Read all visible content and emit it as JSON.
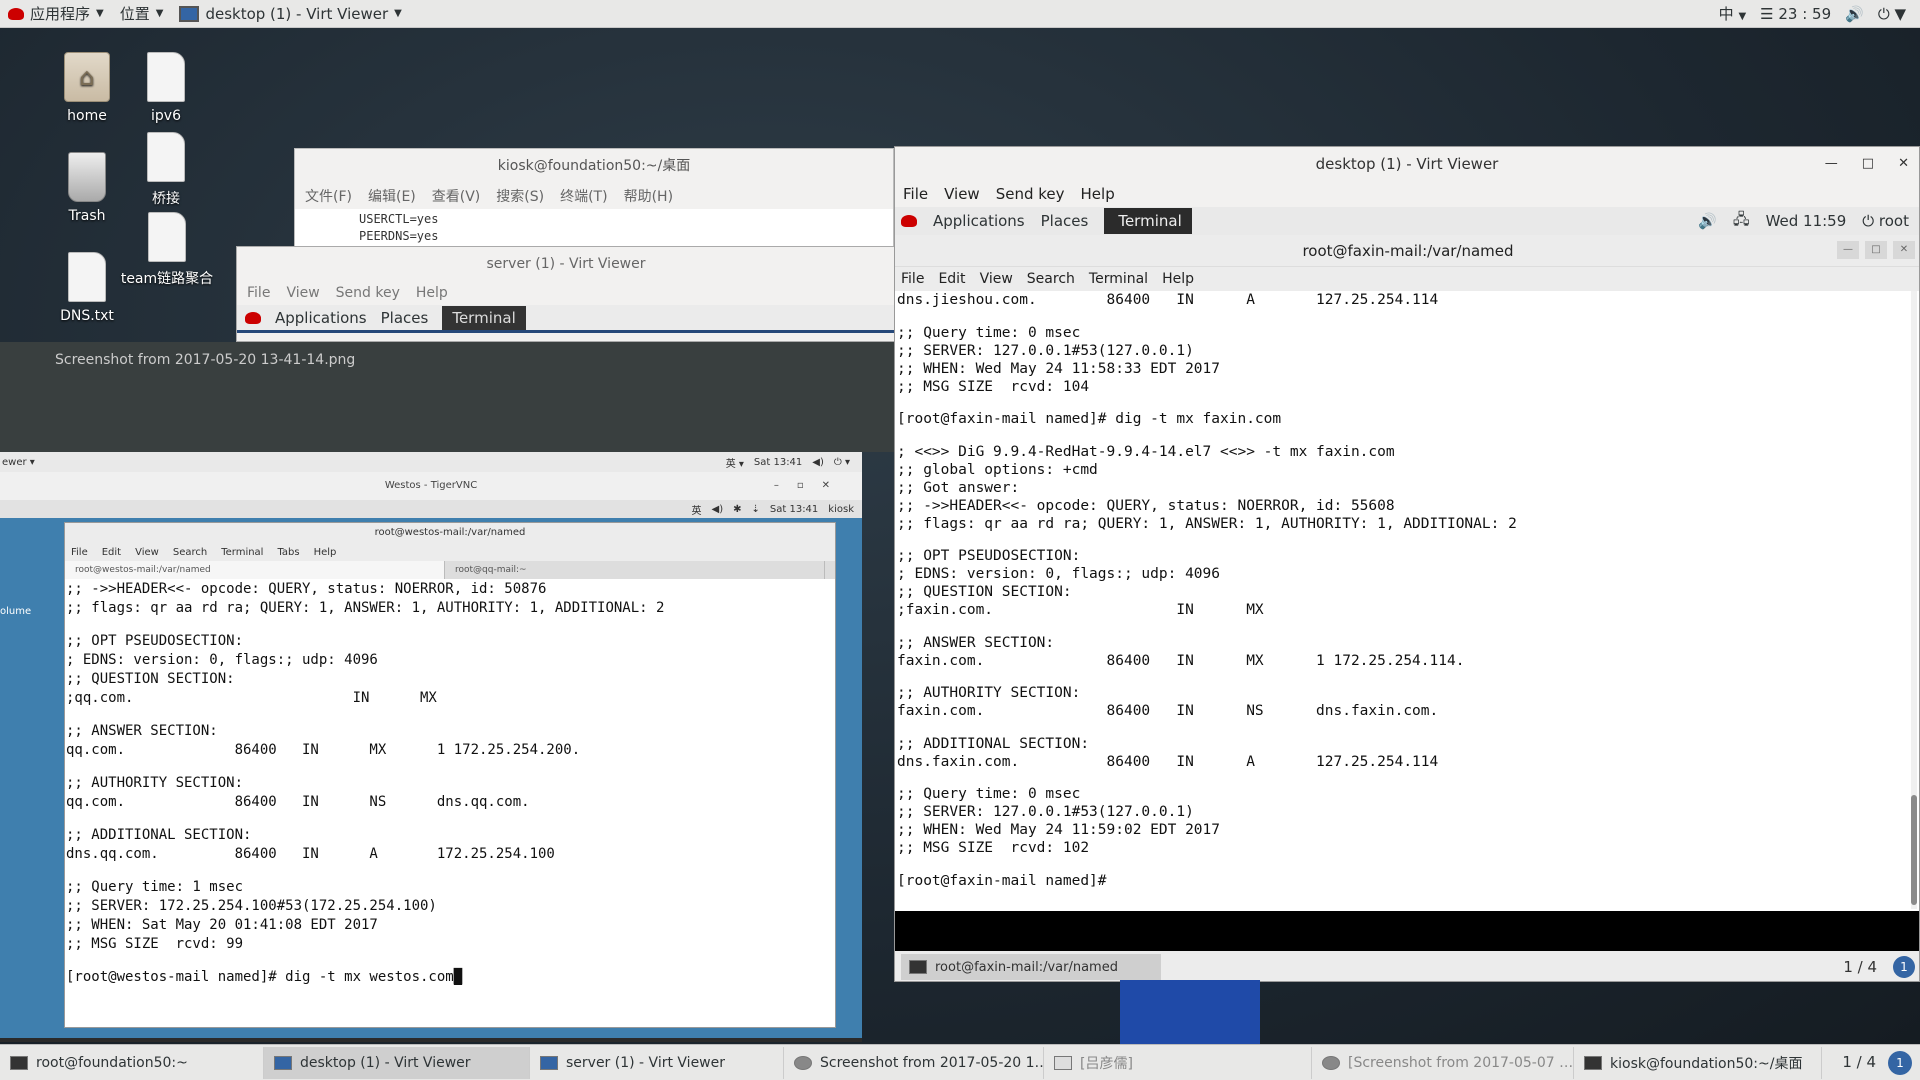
{
  "topbar": {
    "apps": "应用程序",
    "places": "位置",
    "window": "desktop (1) - Virt Viewer",
    "input": "中",
    "clock": "23 : 59"
  },
  "desktop_icons": [
    {
      "label": "home"
    },
    {
      "label": "ipv6"
    },
    {
      "label": "Trash"
    },
    {
      "label": "桥接"
    },
    {
      "label": "team链路聚合"
    },
    {
      "label": "DNS.txt"
    }
  ],
  "gedit": {
    "title": "kiosk@foundation50:~/桌面",
    "menus": [
      "文件(F)",
      "编辑(E)",
      "查看(V)",
      "搜索(S)",
      "终端(T)",
      "帮助(H)"
    ],
    "lines": [
      "USERCTL=yes",
      "PEERDNS=yes"
    ]
  },
  "server_viewer": {
    "title": "server (1) - Virt Viewer",
    "menus": [
      "File",
      "View",
      "Send key",
      "Help"
    ],
    "gbar": {
      "apps": "Applications",
      "places": "Places",
      "terminal": "Terminal"
    }
  },
  "image_viewer": {
    "caption": "Screenshot from 2017-05-20 13-41-14.png"
  },
  "vnc": {
    "outer_left": "ewer ▾",
    "outer_right": [
      "英 ▾",
      "Sat 13:41",
      "◀)",
      "⏻ ▾"
    ],
    "title": "Westos - TigerVNC",
    "inner_right": [
      "英",
      "◀)",
      "✱",
      "⇣",
      "Sat 13:41",
      "kiosk"
    ],
    "desk_label": "olume",
    "term_title": "root@westos-mail:/var/named",
    "menus": [
      "File",
      "Edit",
      "View",
      "Search",
      "Terminal",
      "Tabs",
      "Help"
    ],
    "tabs": [
      "root@westos-mail:/var/named",
      "root@qq-mail:~"
    ],
    "lines": [
      ";; ->>HEADER<<- opcode: QUERY, status: NOERROR, id: 50876",
      ";; flags: qr aa rd ra; QUERY: 1, ANSWER: 1, AUTHORITY: 1, ADDITIONAL: 2",
      "",
      ";; OPT PSEUDOSECTION:",
      "; EDNS: version: 0, flags:; udp: 4096",
      ";; QUESTION SECTION:",
      ";qq.com.                          IN      MX",
      "",
      ";; ANSWER SECTION:",
      "qq.com.             86400   IN      MX      1 172.25.254.200.",
      "",
      ";; AUTHORITY SECTION:",
      "qq.com.             86400   IN      NS      dns.qq.com.",
      "",
      ";; ADDITIONAL SECTION:",
      "dns.qq.com.         86400   IN      A       172.25.254.100",
      "",
      ";; Query time: 1 msec",
      ";; SERVER: 172.25.254.100#53(172.25.254.100)",
      ";; WHEN: Sat May 20 01:41:08 EDT 2017",
      ";; MSG SIZE  rcvd: 99",
      ""
    ],
    "prompt": "[root@westos-mail named]# dig -t mx westos.com"
  },
  "desk1_viewer": {
    "title": "desktop (1) - Virt Viewer",
    "menus": [
      "File",
      "View",
      "Send key",
      "Help"
    ],
    "gbar": {
      "apps": "Applications",
      "places": "Places",
      "terminal": "Terminal",
      "clock": "Wed 11:59",
      "user": "root"
    },
    "term_title": "root@faxin-mail:/var/named",
    "term_menus": [
      "File",
      "Edit",
      "View",
      "Search",
      "Terminal",
      "Help"
    ],
    "lines": [
      "dns.jieshou.com.        86400   IN      A       127.25.254.114",
      "",
      ";; Query time: 0 msec",
      ";; SERVER: 127.0.0.1#53(127.0.0.1)",
      ";; WHEN: Wed May 24 11:58:33 EDT 2017",
      ";; MSG SIZE  rcvd: 104",
      "",
      "[root@faxin-mail named]# dig -t mx faxin.com",
      "",
      "; <<>> DiG 9.9.4-RedHat-9.9.4-14.el7 <<>> -t mx faxin.com",
      ";; global options: +cmd",
      ";; Got answer:",
      ";; ->>HEADER<<- opcode: QUERY, status: NOERROR, id: 55608",
      ";; flags: qr aa rd ra; QUERY: 1, ANSWER: 1, AUTHORITY: 1, ADDITIONAL: 2",
      "",
      ";; OPT PSEUDOSECTION:",
      "; EDNS: version: 0, flags:; udp: 4096",
      ";; QUESTION SECTION:",
      ";faxin.com.                     IN      MX",
      "",
      ";; ANSWER SECTION:",
      "faxin.com.              86400   IN      MX      1 172.25.254.114.",
      "",
      ";; AUTHORITY SECTION:",
      "faxin.com.              86400   IN      NS      dns.faxin.com.",
      "",
      ";; ADDITIONAL SECTION:",
      "dns.faxin.com.          86400   IN      A       127.25.254.114",
      "",
      ";; Query time: 0 msec",
      ";; SERVER: 127.0.0.1#53(127.0.0.1)",
      ";; WHEN: Wed May 24 11:59:02 EDT 2017",
      ";; MSG SIZE  rcvd: 102",
      "",
      "[root@faxin-mail named]#"
    ],
    "task_item": "root@faxin-mail:/var/named",
    "pager": "1 / 4",
    "badge": "1"
  },
  "taskbar": {
    "items": [
      "root@foundation50:~",
      "desktop (1) - Virt Viewer",
      "server (1) - Virt Viewer",
      "Screenshot from 2017-05-20 1…",
      "[吕彦儒]",
      "[Screenshot from 2017-05-07 …",
      "kiosk@foundation50:~/桌面"
    ],
    "pager": "1 / 4",
    "badge": "1"
  }
}
